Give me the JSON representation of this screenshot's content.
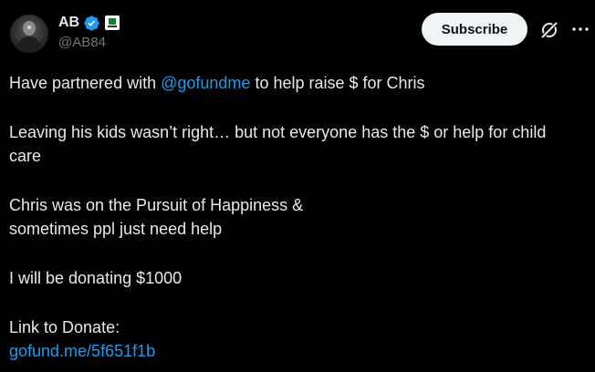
{
  "author": {
    "display_name": "AB",
    "handle": "@AB84",
    "verified_icon": "verified-badge-icon",
    "affiliate_icon": "affiliate-badge-icon"
  },
  "actions": {
    "subscribe_label": "Subscribe",
    "grok_icon": "grok-icon",
    "more_icon": "more-options-icon"
  },
  "tweet": {
    "p1_before": "Have partnered with ",
    "p1_mention": "@gofundme",
    "p1_after": " to help raise $ for Chris",
    "p2_line1": "Leaving his kids wasn’t right… but not everyone has the $ or help for child",
    "p2_line2": "care",
    "p3_line1": "Chris was on the Pursuit of Happiness &",
    "p3_line2": "sometimes ppl just need help",
    "p4": "I will be donating $1000",
    "p5_label": "Link to Donate:",
    "p5_link": "gofund.me/5f651f1b"
  },
  "colors": {
    "background": "#000000",
    "text": "#e7e9ea",
    "secondary_text": "#71767b",
    "link": "#1d9bf0",
    "subscribe_bg": "#eff3f4",
    "verified": "#1d9bf0"
  }
}
